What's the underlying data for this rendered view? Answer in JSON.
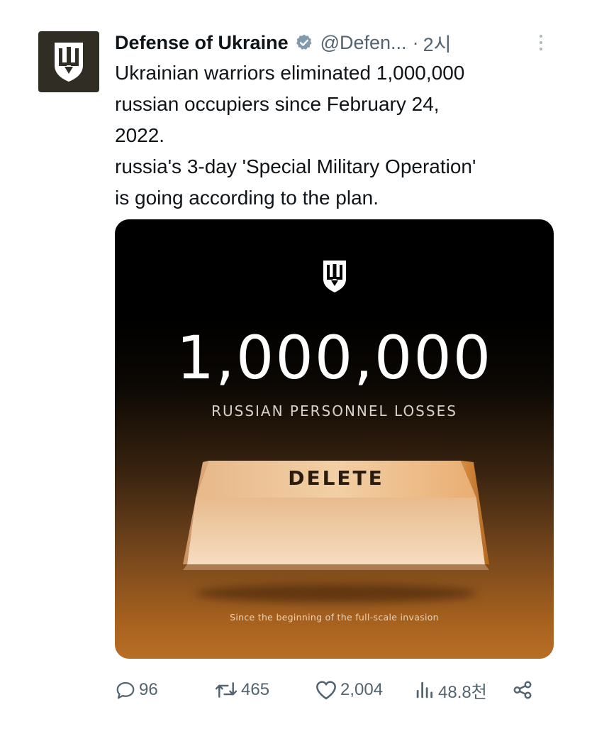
{
  "post": {
    "author": {
      "display_name": "Defense of Ukraine",
      "handle": "@Defen...",
      "dot": "·",
      "time": "2시",
      "verified": true,
      "avatar_icon": "ukraine-trident-icon"
    },
    "text_lines": [
      "Ukrainian warriors eliminated 1,000,000",
      "russian occupiers since February 24,",
      "2022.",
      "russia's 3-day 'Special Military Operation'",
      "is going according to the plan."
    ],
    "media": {
      "emblem_icon": "trident-shield-icon",
      "big_number": "1,000,000",
      "subtitle": "RUSSIAN PERSONNEL LOSSES",
      "key_label": "DELETE",
      "caption": "Since the beginning of the full-scale invasion"
    },
    "actions": {
      "replies": "96",
      "reposts": "465",
      "likes": "2,004",
      "views": "48.8천"
    }
  },
  "colors": {
    "text": "#0f1419",
    "secondary": "#536471",
    "verified_badge": "#829aab",
    "avatar_bg": "#302d24"
  }
}
